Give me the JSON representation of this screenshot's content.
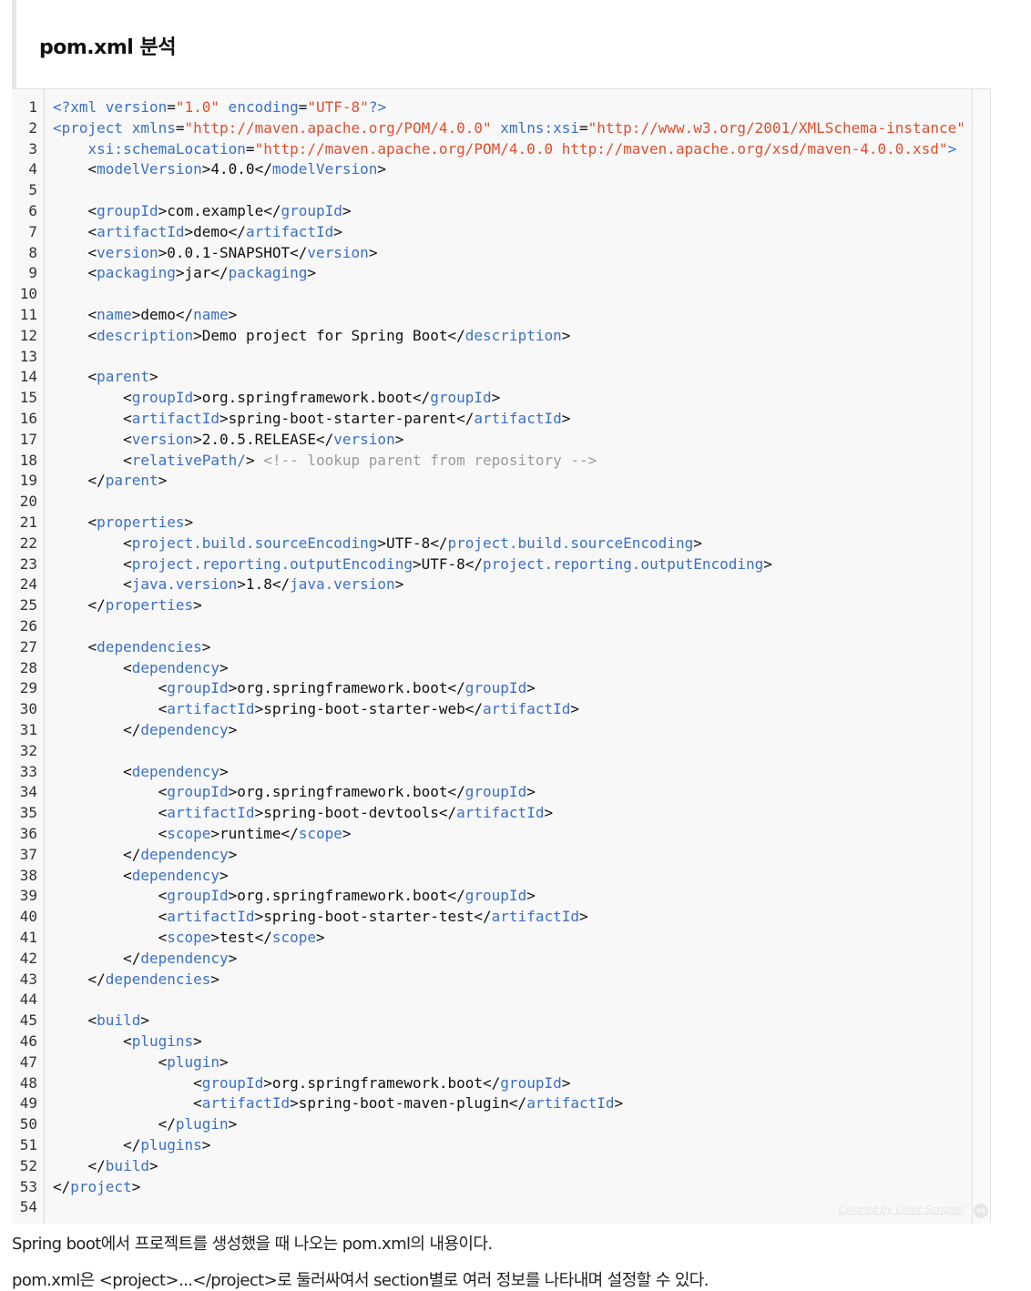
{
  "heading": "pom.xml 분석",
  "code": {
    "lines": [
      [
        [
          "t",
          "<?xml "
        ],
        [
          "a",
          "version"
        ],
        [
          "p",
          "="
        ],
        [
          "v",
          "\"1.0\""
        ],
        [
          "a",
          " encoding"
        ],
        [
          "p",
          "="
        ],
        [
          "v",
          "\"UTF-8\""
        ],
        [
          "t",
          "?>"
        ]
      ],
      [
        [
          "t",
          "<project "
        ],
        [
          "a",
          "xmlns"
        ],
        [
          "p",
          "="
        ],
        [
          "v",
          "\"http://maven.apache.org/POM/4.0.0\""
        ],
        [
          "a",
          " xmlns:xsi"
        ],
        [
          "p",
          "="
        ],
        [
          "v",
          "\"http://www.w3.org/2001/XMLSchema-instance\""
        ]
      ],
      [
        [
          "p",
          "    "
        ],
        [
          "a",
          "xsi:schemaLocation"
        ],
        [
          "p",
          "="
        ],
        [
          "v",
          "\"http://maven.apache.org/POM/4.0.0 http://maven.apache.org/xsd/maven-4.0.0.xsd\""
        ],
        [
          "t",
          ">"
        ]
      ],
      [
        [
          "p",
          "    <"
        ],
        [
          "t",
          "modelVersion"
        ],
        [
          "p",
          ">4.0.0</"
        ],
        [
          "t",
          "modelVersion"
        ],
        [
          "p",
          ">"
        ]
      ],
      [],
      [
        [
          "p",
          "    <"
        ],
        [
          "t",
          "groupId"
        ],
        [
          "p",
          ">com.example</"
        ],
        [
          "t",
          "groupId"
        ],
        [
          "p",
          ">"
        ]
      ],
      [
        [
          "p",
          "    <"
        ],
        [
          "t",
          "artifactId"
        ],
        [
          "p",
          ">demo</"
        ],
        [
          "t",
          "artifactId"
        ],
        [
          "p",
          ">"
        ]
      ],
      [
        [
          "p",
          "    <"
        ],
        [
          "t",
          "version"
        ],
        [
          "p",
          ">0.0.1-SNAPSHOT</"
        ],
        [
          "t",
          "version"
        ],
        [
          "p",
          ">"
        ]
      ],
      [
        [
          "p",
          "    <"
        ],
        [
          "t",
          "packaging"
        ],
        [
          "p",
          ">jar</"
        ],
        [
          "t",
          "packaging"
        ],
        [
          "p",
          ">"
        ]
      ],
      [],
      [
        [
          "p",
          "    <"
        ],
        [
          "t",
          "name"
        ],
        [
          "p",
          ">demo</"
        ],
        [
          "t",
          "name"
        ],
        [
          "p",
          ">"
        ]
      ],
      [
        [
          "p",
          "    <"
        ],
        [
          "t",
          "description"
        ],
        [
          "p",
          ">Demo project for Spring Boot</"
        ],
        [
          "t",
          "description"
        ],
        [
          "p",
          ">"
        ]
      ],
      [],
      [
        [
          "p",
          "    <"
        ],
        [
          "t",
          "parent"
        ],
        [
          "p",
          ">"
        ]
      ],
      [
        [
          "p",
          "        <"
        ],
        [
          "t",
          "groupId"
        ],
        [
          "p",
          ">org.springframework.boot</"
        ],
        [
          "t",
          "groupId"
        ],
        [
          "p",
          ">"
        ]
      ],
      [
        [
          "p",
          "        <"
        ],
        [
          "t",
          "artifactId"
        ],
        [
          "p",
          ">spring-boot-starter-parent</"
        ],
        [
          "t",
          "artifactId"
        ],
        [
          "p",
          ">"
        ]
      ],
      [
        [
          "p",
          "        <"
        ],
        [
          "t",
          "version"
        ],
        [
          "p",
          ">2.0.5.RELEASE</"
        ],
        [
          "t",
          "version"
        ],
        [
          "p",
          ">"
        ]
      ],
      [
        [
          "p",
          "        <"
        ],
        [
          "t",
          "relativePath/"
        ],
        [
          "p",
          "> "
        ],
        [
          "c",
          "<!-- lookup parent from repository -->"
        ]
      ],
      [
        [
          "p",
          "    </"
        ],
        [
          "t",
          "parent"
        ],
        [
          "p",
          ">"
        ]
      ],
      [],
      [
        [
          "p",
          "    <"
        ],
        [
          "t",
          "properties"
        ],
        [
          "p",
          ">"
        ]
      ],
      [
        [
          "p",
          "        <"
        ],
        [
          "t",
          "project.build.sourceEncoding"
        ],
        [
          "p",
          ">UTF-8</"
        ],
        [
          "t",
          "project.build.sourceEncoding"
        ],
        [
          "p",
          ">"
        ]
      ],
      [
        [
          "p",
          "        <"
        ],
        [
          "t",
          "project.reporting.outputEncoding"
        ],
        [
          "p",
          ">UTF-8</"
        ],
        [
          "t",
          "project.reporting.outputEncoding"
        ],
        [
          "p",
          ">"
        ]
      ],
      [
        [
          "p",
          "        <"
        ],
        [
          "t",
          "java.version"
        ],
        [
          "p",
          ">1.8</"
        ],
        [
          "t",
          "java.version"
        ],
        [
          "p",
          ">"
        ]
      ],
      [
        [
          "p",
          "    </"
        ],
        [
          "t",
          "properties"
        ],
        [
          "p",
          ">"
        ]
      ],
      [],
      [
        [
          "p",
          "    <"
        ],
        [
          "t",
          "dependencies"
        ],
        [
          "p",
          ">"
        ]
      ],
      [
        [
          "p",
          "        <"
        ],
        [
          "t",
          "dependency"
        ],
        [
          "p",
          ">"
        ]
      ],
      [
        [
          "p",
          "            <"
        ],
        [
          "t",
          "groupId"
        ],
        [
          "p",
          ">org.springframework.boot</"
        ],
        [
          "t",
          "groupId"
        ],
        [
          "p",
          ">"
        ]
      ],
      [
        [
          "p",
          "            <"
        ],
        [
          "t",
          "artifactId"
        ],
        [
          "p",
          ">spring-boot-starter-web</"
        ],
        [
          "t",
          "artifactId"
        ],
        [
          "p",
          ">"
        ]
      ],
      [
        [
          "p",
          "        </"
        ],
        [
          "t",
          "dependency"
        ],
        [
          "p",
          ">"
        ]
      ],
      [],
      [
        [
          "p",
          "        <"
        ],
        [
          "t",
          "dependency"
        ],
        [
          "p",
          ">"
        ]
      ],
      [
        [
          "p",
          "            <"
        ],
        [
          "t",
          "groupId"
        ],
        [
          "p",
          ">org.springframework.boot</"
        ],
        [
          "t",
          "groupId"
        ],
        [
          "p",
          ">"
        ]
      ],
      [
        [
          "p",
          "            <"
        ],
        [
          "t",
          "artifactId"
        ],
        [
          "p",
          ">spring-boot-devtools</"
        ],
        [
          "t",
          "artifactId"
        ],
        [
          "p",
          ">"
        ]
      ],
      [
        [
          "p",
          "            <"
        ],
        [
          "t",
          "scope"
        ],
        [
          "p",
          ">runtime</"
        ],
        [
          "t",
          "scope"
        ],
        [
          "p",
          ">"
        ]
      ],
      [
        [
          "p",
          "        </"
        ],
        [
          "t",
          "dependency"
        ],
        [
          "p",
          ">"
        ]
      ],
      [
        [
          "p",
          "        <"
        ],
        [
          "t",
          "dependency"
        ],
        [
          "p",
          ">"
        ]
      ],
      [
        [
          "p",
          "            <"
        ],
        [
          "t",
          "groupId"
        ],
        [
          "p",
          ">org.springframework.boot</"
        ],
        [
          "t",
          "groupId"
        ],
        [
          "p",
          ">"
        ]
      ],
      [
        [
          "p",
          "            <"
        ],
        [
          "t",
          "artifactId"
        ],
        [
          "p",
          ">spring-boot-starter-test</"
        ],
        [
          "t",
          "artifactId"
        ],
        [
          "p",
          ">"
        ]
      ],
      [
        [
          "p",
          "            <"
        ],
        [
          "t",
          "scope"
        ],
        [
          "p",
          ">test</"
        ],
        [
          "t",
          "scope"
        ],
        [
          "p",
          ">"
        ]
      ],
      [
        [
          "p",
          "        </"
        ],
        [
          "t",
          "dependency"
        ],
        [
          "p",
          ">"
        ]
      ],
      [
        [
          "p",
          "    </"
        ],
        [
          "t",
          "dependencies"
        ],
        [
          "p",
          ">"
        ]
      ],
      [],
      [
        [
          "p",
          "    <"
        ],
        [
          "t",
          "build"
        ],
        [
          "p",
          ">"
        ]
      ],
      [
        [
          "p",
          "        <"
        ],
        [
          "t",
          "plugins"
        ],
        [
          "p",
          ">"
        ]
      ],
      [
        [
          "p",
          "            <"
        ],
        [
          "t",
          "plugin"
        ],
        [
          "p",
          ">"
        ]
      ],
      [
        [
          "p",
          "                <"
        ],
        [
          "t",
          "groupId"
        ],
        [
          "p",
          ">org.springframework.boot</"
        ],
        [
          "t",
          "groupId"
        ],
        [
          "p",
          ">"
        ]
      ],
      [
        [
          "p",
          "                <"
        ],
        [
          "t",
          "artifactId"
        ],
        [
          "p",
          ">spring-boot-maven-plugin</"
        ],
        [
          "t",
          "artifactId"
        ],
        [
          "p",
          ">"
        ]
      ],
      [
        [
          "p",
          "            </"
        ],
        [
          "t",
          "plugin"
        ],
        [
          "p",
          ">"
        ]
      ],
      [
        [
          "p",
          "        </"
        ],
        [
          "t",
          "plugins"
        ],
        [
          "p",
          ">"
        ]
      ],
      [
        [
          "p",
          "    </"
        ],
        [
          "t",
          "build"
        ],
        [
          "p",
          ">"
        ]
      ],
      [
        [
          "p",
          "</"
        ],
        [
          "t",
          "project"
        ],
        [
          "p",
          ">"
        ]
      ],
      []
    ],
    "credit": "Colored by Color Scripter",
    "credit_logo": "cs"
  },
  "paragraphs": [
    "Spring boot에서 프로젝트를 생성했을 때 나오는 pom.xml의 내용이다.",
    "pom.xml은 <project>...</project>로 둘러싸여서 section별로 여러 정보를 나타내며 설정할 수 있다."
  ]
}
